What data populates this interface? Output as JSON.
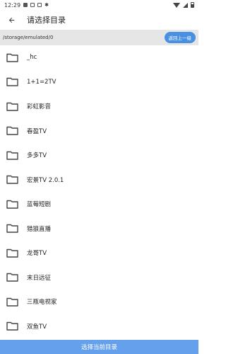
{
  "status_bar": {
    "time": "12:29",
    "icons": [
      "image-icon",
      "download-icon",
      "square-icon",
      "bug-icon",
      "wifi-icon",
      "signal-icon",
      "battery-icon"
    ]
  },
  "header": {
    "title": "请选择目录",
    "back_icon": "arrow-left-icon"
  },
  "path_bar": {
    "current_path": "/storage/emulated/0",
    "up_button_label": "返回上一级"
  },
  "folders": [
    {
      "name": "_hc"
    },
    {
      "name": "1+1=2TV"
    },
    {
      "name": "彩虹影音"
    },
    {
      "name": "春盈TV"
    },
    {
      "name": "多多TV"
    },
    {
      "name": "宏景TV 2.0.1"
    },
    {
      "name": "蓝莓短剧"
    },
    {
      "name": "猎狼直播"
    },
    {
      "name": "龙哥TV"
    },
    {
      "name": "末日远征"
    },
    {
      "name": "三瓶电视家"
    },
    {
      "name": "双鱼TV"
    }
  ],
  "footer": {
    "select_button_label": "选择当前目录"
  },
  "colors": {
    "accent": "#4a90e2",
    "footer": "#64a0ec",
    "path_bar_bg": "#e6e6e6"
  }
}
